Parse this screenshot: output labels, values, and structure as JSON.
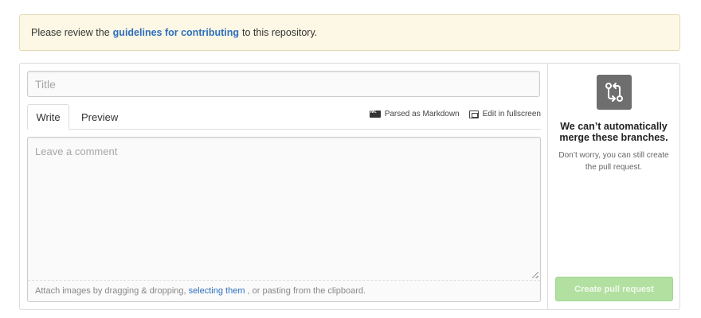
{
  "flash": {
    "text_before": "Please review the",
    "link": "guidelines for contributing",
    "text_after": "to this repository."
  },
  "form": {
    "title_placeholder": "Title",
    "title_value": "",
    "tabs": [
      {
        "label": "Write",
        "active": true
      },
      {
        "label": "Preview",
        "active": false
      }
    ],
    "toolbar": {
      "markdown_label": "Parsed as Markdown",
      "fullscreen_label": "Edit in fullscreen"
    },
    "comment_placeholder": "Leave a comment",
    "comment_value": "",
    "attach": {
      "text_before": "Attach images by dragging & dropping,",
      "link": "selecting them",
      "text_after": ", or pasting from the clipboard."
    }
  },
  "sidebar": {
    "icon": "git-compare-icon",
    "merge_title": "We can’t automatically merge these branches.",
    "merge_note": "Don’t worry, you can still create the pull request.",
    "create_button": "Create pull request"
  },
  "colors": {
    "flash_bg": "#fdf8e5",
    "link": "#2e6ebd",
    "button_disabled": "#b2e0a0",
    "icon_bg": "#6e6e6e"
  }
}
